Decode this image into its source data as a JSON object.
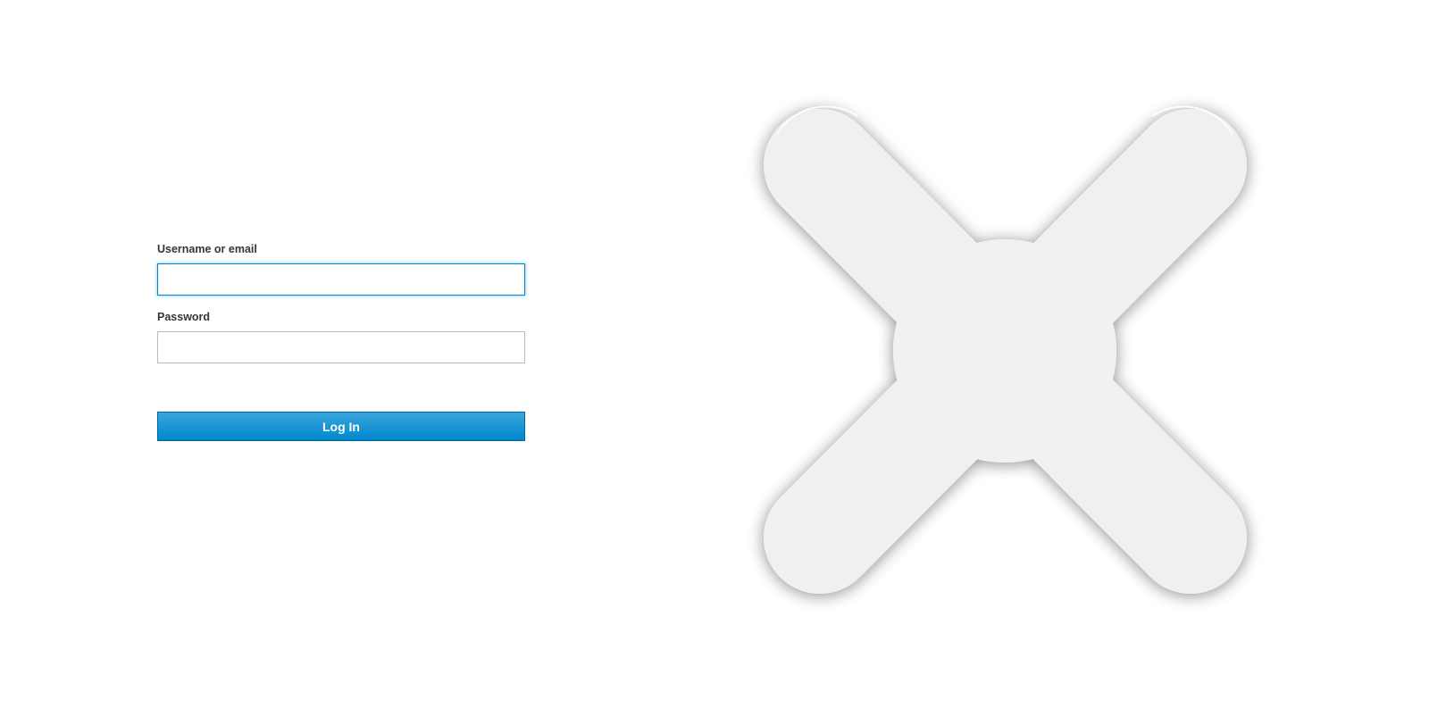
{
  "form": {
    "username_label": "Username or email",
    "username_value": "",
    "password_label": "Password",
    "password_value": "",
    "login_label": "Log In"
  },
  "logo": {
    "icon": "x-logo-icon"
  },
  "colors": {
    "accent": "#0088ce",
    "accent_light": "#39a5dc",
    "logo_fill": "#f3f3f3"
  }
}
